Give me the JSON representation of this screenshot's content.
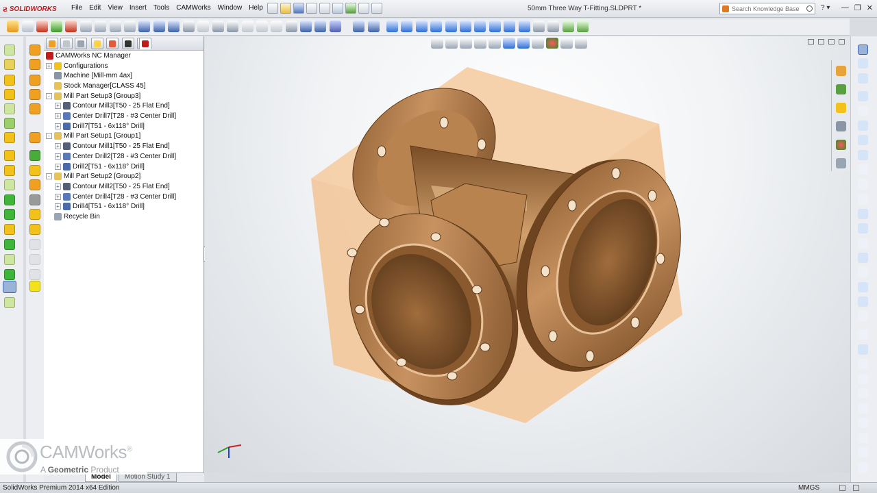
{
  "app": {
    "brand": "SOLIDWORKS",
    "document_title": "50mm Three Way T-Fitting.SLDPRT *"
  },
  "menu": {
    "items": [
      "File",
      "Edit",
      "View",
      "Insert",
      "Tools",
      "CAMWorks",
      "Window",
      "Help"
    ]
  },
  "search": {
    "placeholder": "Search Knowledge Base"
  },
  "tree": {
    "root": "CAMWorks NC Manager",
    "nodes": [
      {
        "label": "Configurations",
        "indent": 1,
        "icon": "folder-icon",
        "expander": "+"
      },
      {
        "label": "Machine [Mill-mm 4ax]",
        "indent": 1,
        "icon": "machine-icon",
        "expander": ""
      },
      {
        "label": "Stock Manager[CLASS 45]",
        "indent": 1,
        "icon": "stock-icon",
        "expander": ""
      },
      {
        "label": "Mill Part Setup3 [Group3]",
        "indent": 1,
        "icon": "setup-icon",
        "expander": "-"
      },
      {
        "label": "Contour Mill3[T50 - 25 Flat End]",
        "indent": 2,
        "icon": "contour-mill-icon",
        "expander": "+"
      },
      {
        "label": "Center Drill7[T28 - #3 Center Drill]",
        "indent": 2,
        "icon": "center-drill-icon",
        "expander": "+"
      },
      {
        "label": "Drill7[T51 - 6x118° Drill]",
        "indent": 2,
        "icon": "drill-icon",
        "expander": "+"
      },
      {
        "label": "Mill Part Setup1 [Group1]",
        "indent": 1,
        "icon": "setup-icon",
        "expander": "-"
      },
      {
        "label": "Contour Mill1[T50 - 25 Flat End]",
        "indent": 2,
        "icon": "contour-mill-icon",
        "expander": "+"
      },
      {
        "label": "Center Drill2[T28 - #3 Center Drill]",
        "indent": 2,
        "icon": "center-drill-icon",
        "expander": "+"
      },
      {
        "label": "Drill2[T51 - 6x118° Drill]",
        "indent": 2,
        "icon": "drill-icon",
        "expander": "+"
      },
      {
        "label": "Mill Part Setup2 [Group2]",
        "indent": 1,
        "icon": "setup-icon",
        "expander": "-"
      },
      {
        "label": "Contour Mill2[T50 - 25 Flat End]",
        "indent": 2,
        "icon": "contour-mill-icon",
        "expander": "+"
      },
      {
        "label": "Center Drill4[T28 - #3 Center Drill]",
        "indent": 2,
        "icon": "center-drill-icon",
        "expander": "+"
      },
      {
        "label": "Drill4[T51 - 6x118° Drill]",
        "indent": 2,
        "icon": "drill-icon",
        "expander": "+"
      },
      {
        "label": "Recycle Bin",
        "indent": 1,
        "icon": "recycle-bin-icon",
        "expander": ""
      }
    ]
  },
  "bottom_tabs": {
    "model": "Model",
    "motion": "Motion Study 1"
  },
  "status": {
    "edition": "SolidWorks Premium 2014 x64 Edition",
    "units": "MMGS"
  },
  "watermark": {
    "brand": "CAMWorks",
    "reg": "®",
    "tag_prefix": "A",
    "tag_company": "Geometric",
    "tag_suffix": "Product"
  },
  "colors": {
    "part_bronze": "#b17b46",
    "stock_peach": "#f0c79a",
    "accent_red": "#c21b1b"
  }
}
